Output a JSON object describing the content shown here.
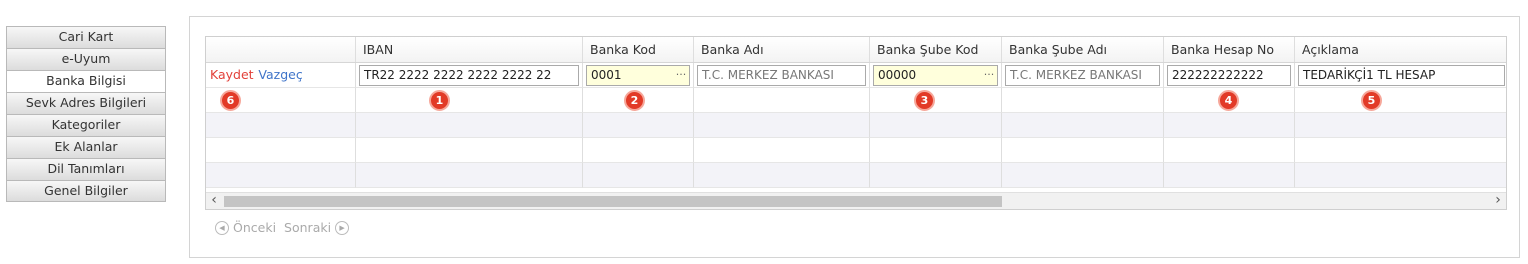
{
  "tabs": [
    {
      "label": "Cari Kart"
    },
    {
      "label": "e-Uyum"
    },
    {
      "label": "Banka Bilgisi"
    },
    {
      "label": "Sevk Adres Bilgileri"
    },
    {
      "label": "Kategoriler"
    },
    {
      "label": "Ek Alanlar"
    },
    {
      "label": "Dil Tanımları"
    },
    {
      "label": "Genel Bilgiler"
    }
  ],
  "active_tab": "Banka Bilgisi",
  "grid": {
    "columns": [
      "",
      "IBAN",
      "Banka Kod",
      "Banka Adı",
      "Banka Şube Kod",
      "Banka Şube Adı",
      "Banka Hesap No",
      "Açıklama"
    ],
    "edit_row": {
      "save_label": "Kaydet",
      "cancel_label": "Vazgeç",
      "iban": "TR22 2222 2222 2222 2222 22",
      "banka_kod": "0001",
      "banka_adi": "T.C. MERKEZ BANKASI",
      "sube_kod": "00000",
      "sube_adi": "T.C. MERKEZ BANKASI",
      "hesap_no": "222222222222",
      "aciklama": "TEDARİKÇİ1 TL HESAP"
    },
    "badges": [
      "1",
      "2",
      "3",
      "4",
      "5",
      "6"
    ],
    "ellipsis": "···",
    "scroll_left": "‹",
    "scroll_right": "›"
  },
  "pager": {
    "prev_label": "Önceki",
    "next_label": "Sonraki"
  },
  "colors": {
    "save": "#e2413a",
    "cancel": "#3f74c9",
    "badge": "#e23a27",
    "lookup_field": "#ffffdc"
  }
}
